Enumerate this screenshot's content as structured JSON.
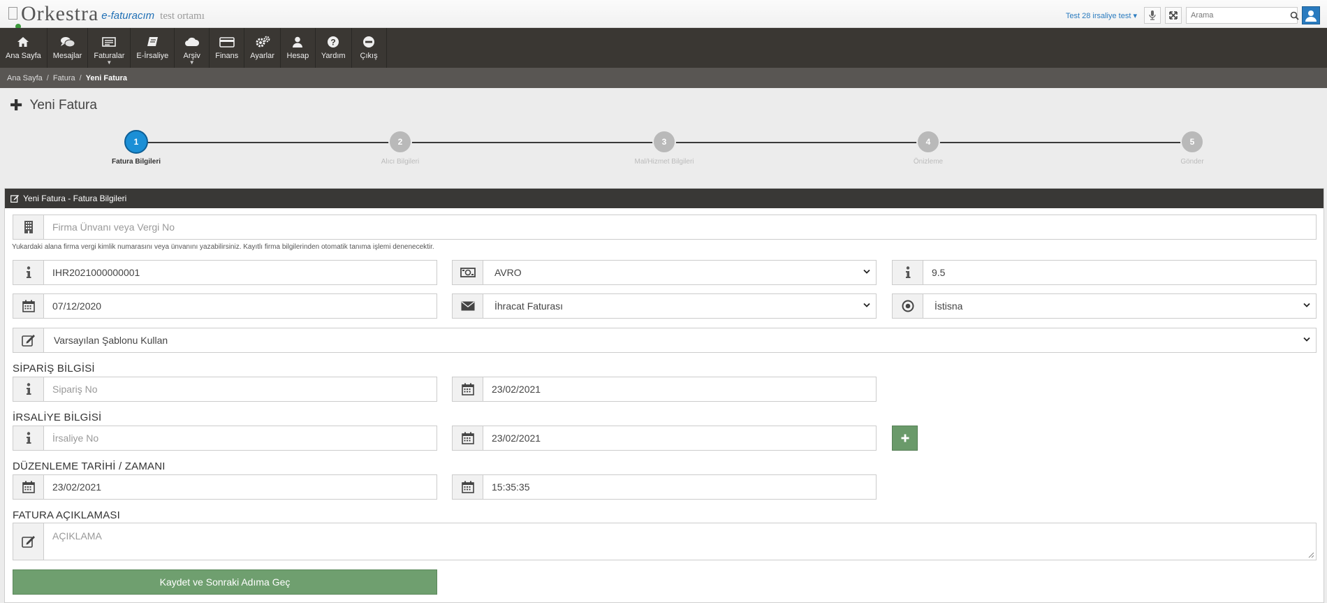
{
  "header": {
    "logo_main": "Orkestra",
    "logo_product": "e-faturacım",
    "logo_env": "test ortamı",
    "user_label": "Test 28 irsaliye test",
    "search_placeholder": "Arama"
  },
  "nav": {
    "items": [
      {
        "label": "Ana Sayfa",
        "icon": "home-icon"
      },
      {
        "label": "Mesajlar",
        "icon": "comments-icon"
      },
      {
        "label": "Faturalar",
        "icon": "invoice-icon"
      },
      {
        "label": "E-İrsaliye",
        "icon": "book-icon"
      },
      {
        "label": "Arşiv",
        "icon": "cloud-icon"
      },
      {
        "label": "Finans",
        "icon": "credit-card-icon"
      },
      {
        "label": "Ayarlar",
        "icon": "gears-icon"
      },
      {
        "label": "Hesap",
        "icon": "user-icon"
      },
      {
        "label": "Yardım",
        "icon": "question-icon"
      },
      {
        "label": "Çıkış",
        "icon": "minus-circle-icon"
      }
    ]
  },
  "breadcrumb": {
    "items": [
      "Ana Sayfa",
      "Fatura",
      "Yeni Fatura"
    ]
  },
  "page": {
    "title": "Yeni Fatura"
  },
  "stepper": {
    "steps": [
      {
        "num": "1",
        "label": "Fatura Bilgileri",
        "active": true
      },
      {
        "num": "2",
        "label": "Alıcı Bilgileri"
      },
      {
        "num": "3",
        "label": "Mal/Hizmet Bilgileri"
      },
      {
        "num": "4",
        "label": "Önizleme"
      },
      {
        "num": "5",
        "label": "Gönder"
      }
    ]
  },
  "panel": {
    "title": "Yeni Fatura - Fatura Bilgileri"
  },
  "form": {
    "company_placeholder": "Firma Ünvanı veya Vergi No",
    "company_hint": "Yukardaki alana firma vergi kimlik numarasını veya ünvanını yazabilirsiniz. Kayıtlı firma bilgilerinden otomatik tanıma işlemi denenecektir.",
    "invoice_no": "IHR2021000000001",
    "currency": "AVRO",
    "exchange_rate": "9.5",
    "invoice_date": "07/12/2020",
    "invoice_type": "İhracat Faturası",
    "invoice_kind": "İstisna",
    "template": "Varsayılan Şablonu Kullan",
    "order_section": "SİPARİŞ BİLGİSİ",
    "order_no_placeholder": "Sipariş No",
    "order_date": "23/02/2021",
    "waybill_section": "İRSALİYE BİLGİSİ",
    "waybill_no_placeholder": "İrsaliye No",
    "waybill_date": "23/02/2021",
    "issue_section": "DÜZENLEME TARİHİ / ZAMANI",
    "issue_date": "23/02/2021",
    "issue_time": "15:35:35",
    "desc_section": "FATURA AÇIKLAMASI",
    "desc_placeholder": "AÇIKLAMA",
    "submit_label": "Kaydet ve Sonraki Adıma Geç"
  },
  "colors": {
    "nav_bg": "#3a3733",
    "breadcrumb_bg": "#595653",
    "active_step": "#1b8fd6",
    "button_green": "#6f9f6f",
    "link_blue": "#2a7bbf"
  }
}
